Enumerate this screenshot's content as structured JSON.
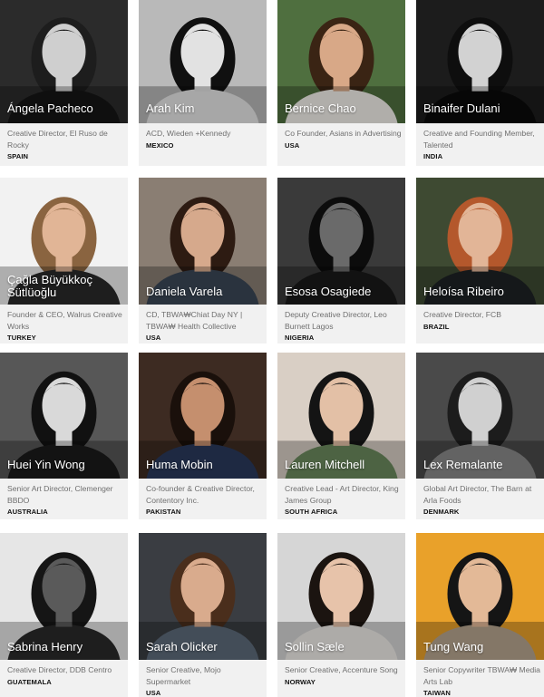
{
  "people": [
    {
      "name": "Ángela Pacheco",
      "role": "Creative Director, El Ruso de Rocky",
      "country": "SPAIN",
      "bg": "#2b2b2b",
      "skin": "#cfcfcf",
      "hair": "#1d1d1d",
      "shirt": "#151515",
      "tone": "bw"
    },
    {
      "name": "Arah Kim",
      "role": "ACD, Wieden +Kennedy",
      "country": "MEXICO",
      "bg": "#b9b9b9",
      "skin": "#e2e2e2",
      "hair": "#101010",
      "shirt": "#e8e8e8",
      "tone": "bw"
    },
    {
      "name": "Bernice Chao",
      "role": "Co Founder, Asians in Advertising",
      "country": "USA",
      "bg": "#4f6f3f",
      "skin": "#d8a887",
      "hair": "#3a2414",
      "shirt": "#f4f1ec",
      "tone": "color"
    },
    {
      "name": "Binaifer Dulani",
      "role": "Creative and Founding Member, Talented",
      "country": "INDIA",
      "bg": "#1c1c1c",
      "skin": "#d2d2d2",
      "hair": "#0e0e0e",
      "shirt": "#0a0a0a",
      "tone": "bw"
    },
    {
      "name": "Çağla Büyükkoç Sütlüoğlu",
      "role": "Founder & CEO, Walrus Creative Works",
      "country": "TURKEY",
      "bg": "#f2f2f2",
      "skin": "#e1b596",
      "hair": "#8a6440",
      "shirt": "#2a2a2a",
      "tone": "color"
    },
    {
      "name": "Daniela Varela",
      "role": "CD, TBWA₩Chiat Day NY | TBWA₩ Health Collective",
      "country": "USA",
      "bg": "#8a7e73",
      "skin": "#d6a98c",
      "hair": "#2d1b12",
      "shirt": "#3b4756",
      "tone": "color"
    },
    {
      "name": "Esosa Osagiede",
      "role": "Deputy Creative Director, Leo Burnett Lagos",
      "country": "NIGERIA",
      "bg": "#3a3a3a",
      "skin": "#6a6a6a",
      "hair": "#0c0c0c",
      "shirt": "#1a1a1a",
      "tone": "bw"
    },
    {
      "name": "Heloísa Ribeiro",
      "role": "Creative Director, FCB",
      "country": "BRAZIL",
      "bg": "#3e4a32",
      "skin": "#e2b597",
      "hair": "#b4582c",
      "shirt": "#1e2224",
      "tone": "color"
    },
    {
      "name": "Huei Yin Wong",
      "role": "Senior Art Director, Clemenger BBDO",
      "country": "AUSTRALIA",
      "bg": "#575757",
      "skin": "#d9d9d9",
      "hair": "#111111",
      "shirt": "#1b1b1b",
      "tone": "bw"
    },
    {
      "name": "Huma Mobin",
      "role": "Co-founder & Creative Director, Contentory Inc.",
      "country": "PAKISTAN",
      "bg": "#3d2b22",
      "skin": "#c58f6e",
      "hair": "#1a100b",
      "shirt": "#2a3a5c",
      "tone": "color"
    },
    {
      "name": "Lauren Mitchell",
      "role": "Creative Lead - Art Director, King James Group",
      "country": "SOUTH AFRICA",
      "bg": "#d9cfc5",
      "skin": "#e3c0a6",
      "hair": "#141414",
      "shirt": "#6b8a5e",
      "tone": "color"
    },
    {
      "name": "Lex Remalante",
      "role": "Global Art Director, The Barn at Arla Foods",
      "country": "DENMARK",
      "bg": "#4a4a4a",
      "skin": "#d0d0d0",
      "hair": "#1c1c1c",
      "shirt": "#8a8a8a",
      "tone": "bw"
    },
    {
      "name": "Sabrina Henry",
      "role": "Creative Director, DDB Centro",
      "country": "GUATEMALA",
      "bg": "#e6e6e6",
      "skin": "#5a5a5a",
      "hair": "#151515",
      "shirt": "#2a2a2a",
      "tone": "bw"
    },
    {
      "name": "Sarah Olicker",
      "role": "Senior Creative, Mojo Supermarket",
      "country": "USA",
      "bg": "#3a3d42",
      "skin": "#d9ab8d",
      "hair": "#4a2e1c",
      "shirt": "#5d6b7a",
      "tone": "color"
    },
    {
      "name": "Sollin Sæle",
      "role": "Senior Creative, Accenture Song",
      "country": "NORWAY",
      "bg": "#d6d6d6",
      "skin": "#e7c3aa",
      "hair": "#1b1410",
      "shirt": "#f0ede9",
      "tone": "color"
    },
    {
      "name": "Tung Wang",
      "role": "Senior Copywriter TBWA₩ Media Arts Lab",
      "country": "TAIWAN",
      "bg": "#e9a12a",
      "skin": "#e3b997",
      "hair": "#151515",
      "shirt": "#b7a58f",
      "tone": "color"
    }
  ]
}
